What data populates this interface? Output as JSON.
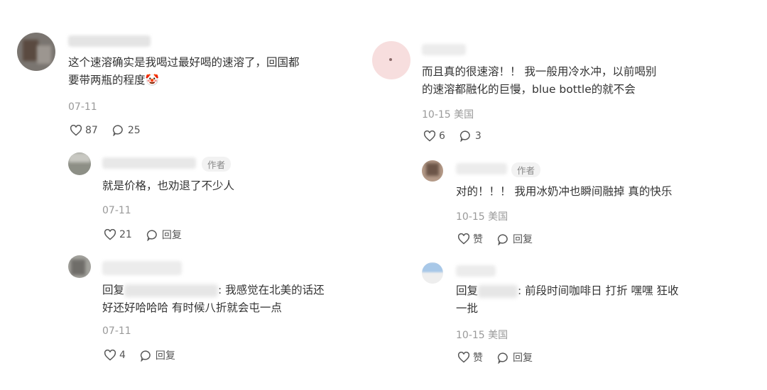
{
  "comments": [
    {
      "text_line1": "这个速溶确实是我喝过最好喝的速溶了，回国都",
      "text_line2": "要带两瓶的程度",
      "emoji": "🤡",
      "date": "07-11",
      "likes": "87",
      "replies_count": "25",
      "replies": [
        {
          "badge": "作者",
          "text_line1": "就是价格，也劝退了不少人",
          "date": "07-11",
          "likes": "21",
          "reply_label": "回复"
        },
        {
          "reply_prefix": "回复",
          "text_line1": ": 我感觉在北美的话还",
          "text_line2": "好还好哈哈哈 有时候八折就会屯一点",
          "date": "07-11",
          "likes": "4",
          "reply_label": "回复"
        }
      ]
    },
    {
      "text_line1": "而且真的很速溶！！ 我一般用冷水冲，以前喝别",
      "text_line2": "的速溶都融化的巨慢，blue bottle的就不会",
      "date": "10-15",
      "location": "美国",
      "likes": "6",
      "replies_count": "3",
      "replies": [
        {
          "badge": "作者",
          "text_line1": "对的！！！ 我用冰奶冲也瞬间融掉 真的快乐",
          "date": "10-15",
          "location": "美国",
          "like_label": "赞",
          "reply_label": "回复"
        },
        {
          "reply_prefix": "回复",
          "text_line1": ": 前段时间咖啡日 打折 嘿嘿 狂收",
          "text_line2": "一批",
          "date": "10-15",
          "location": "美国",
          "like_label": "赞",
          "reply_label": "回复"
        }
      ]
    }
  ],
  "colors": {
    "text": "#333333",
    "meta": "#999999",
    "badge_bg": "#f2f2f2"
  },
  "icons": [
    "heart-icon",
    "comment-bubble-icon",
    "clown-emoji"
  ]
}
